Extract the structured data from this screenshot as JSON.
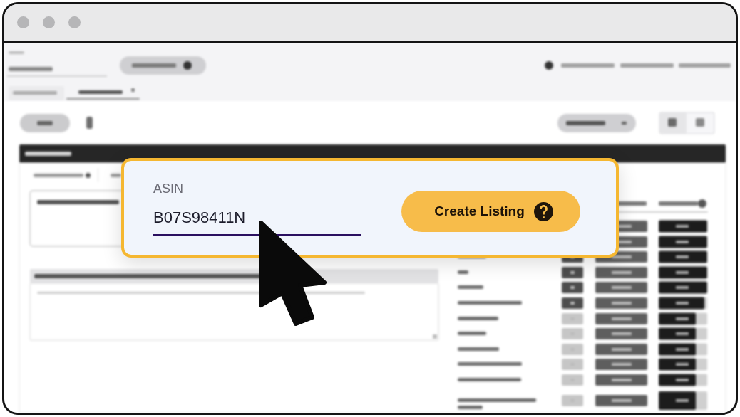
{
  "asin_field": {
    "label": "ASIN",
    "value": "B07S98411N"
  },
  "create_button": {
    "label": "Create Listing"
  }
}
